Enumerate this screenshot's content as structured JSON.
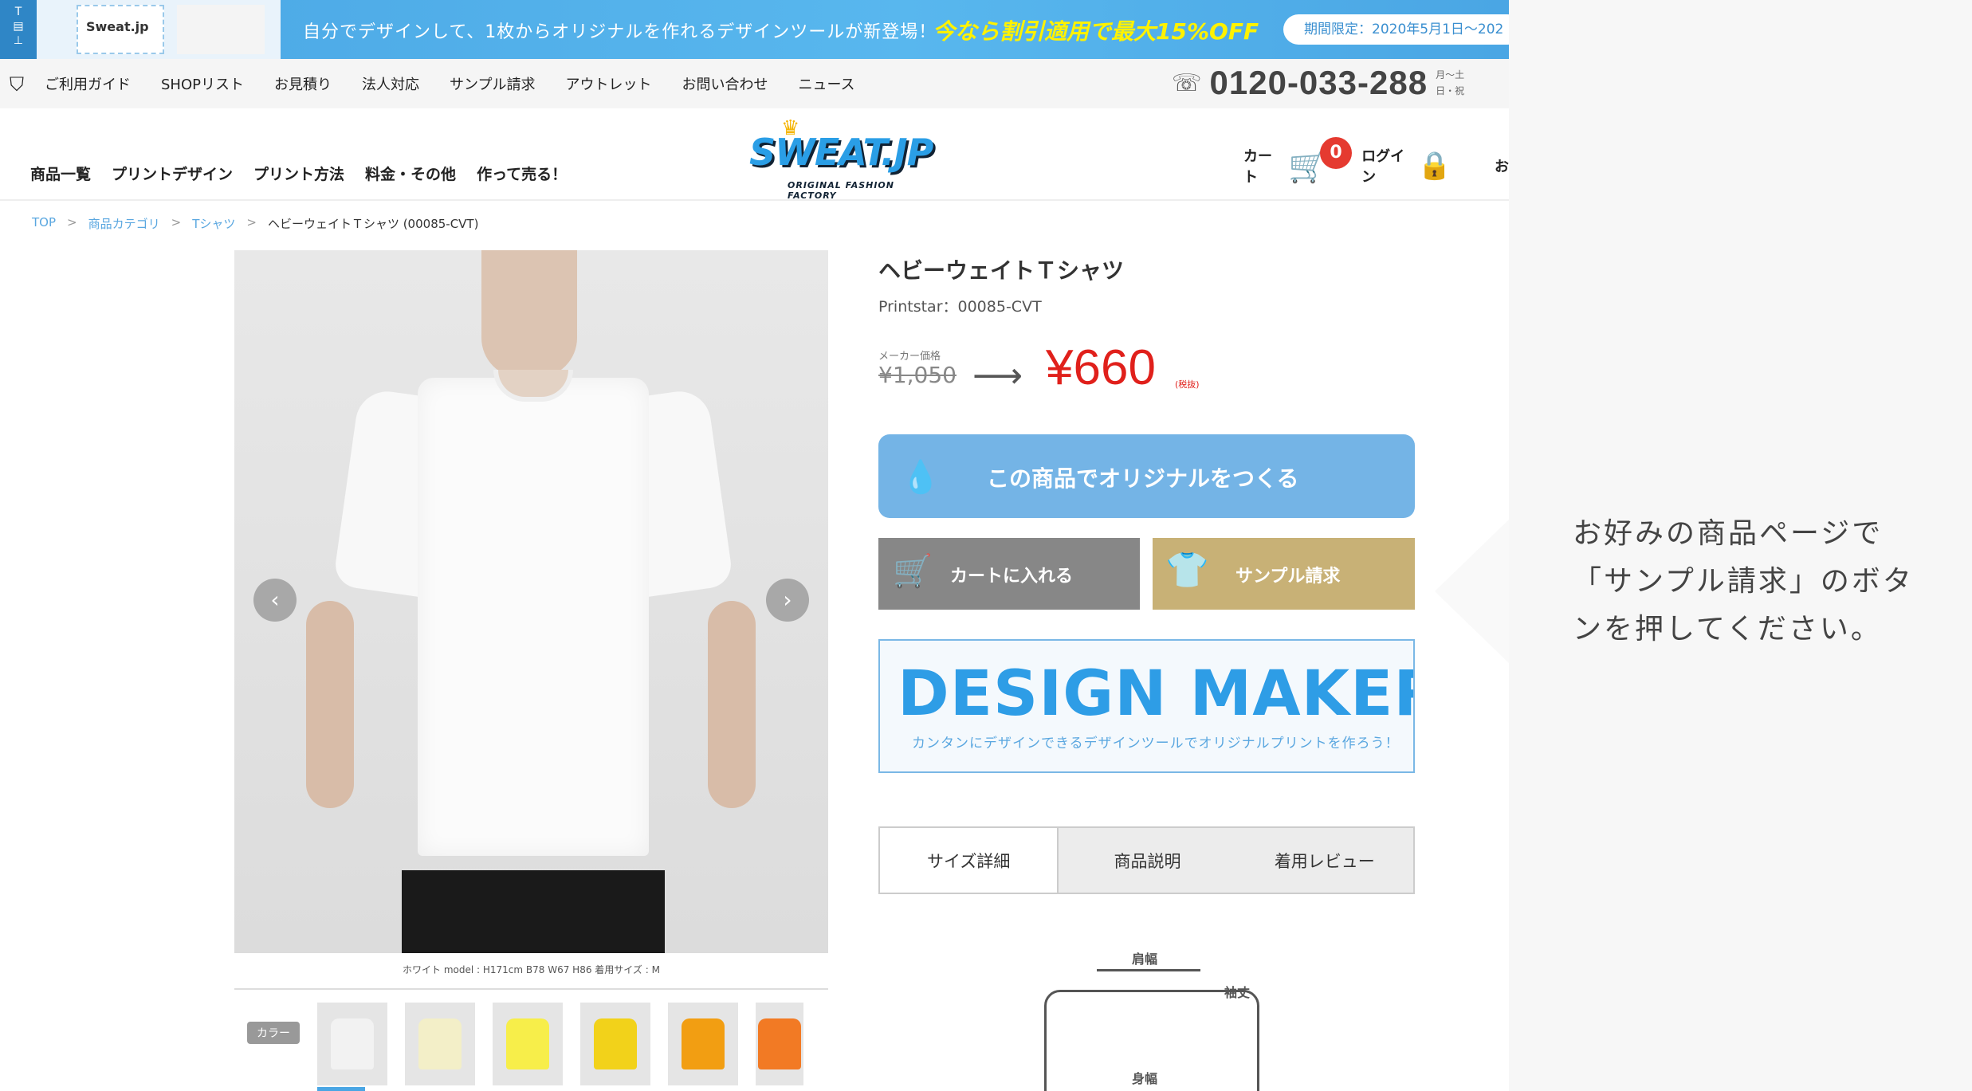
{
  "banner": {
    "tool_icon_top": "T",
    "thumb_logo": "Sweat.jp",
    "text": "自分でデザインして、1枚からオリジナルを作れるデザインツールが新登場！",
    "offer": "今なら割引適用で最大15%OFF",
    "period": "期間限定：2020年5月1日〜202"
  },
  "topnav": {
    "items": [
      "ご利用ガイド",
      "SHOPリスト",
      "お見積り",
      "法人対応",
      "サンプル請求",
      "アウトレット",
      "お問い合わせ",
      "ニュース"
    ],
    "phone": "0120-033-288",
    "hours_1": "月〜土",
    "hours_2": "日・祝"
  },
  "header": {
    "nav": [
      "商品一覧",
      "プリントデザイン",
      "プリント方法",
      "料金・その他",
      "作って売る！"
    ],
    "logo": "SWEAT.JP",
    "logo_tag": "ORIGINAL FASHION FACTORY",
    "cart_label": "カート",
    "cart_count": "0",
    "login_label": "ログイン",
    "more_label": "お"
  },
  "breadcrumb": {
    "items": [
      "TOP",
      "商品カテゴリ",
      "Tシャツ"
    ],
    "current": "ヘビーウェイトＴシャツ (00085-CVT)",
    "separator": ">"
  },
  "gallery": {
    "prev": "‹",
    "next": "›",
    "caption": "ホワイト model : H171cm B78 W67 H86 着用サイズ : M",
    "color_label": "カラー",
    "thumb_colors": [
      "#f2f2f2",
      "#f3efc8",
      "#f7ee4a",
      "#f2d21a",
      "#f29e12",
      "#f27a24"
    ]
  },
  "product": {
    "title": "ヘビーウェイトＴシャツ",
    "code": "Printstar：00085-CVT",
    "maker_price_label": "メーカー価格",
    "maker_price": "¥1,050",
    "price": "¥660",
    "tax": "(税抜)"
  },
  "actions": {
    "original": "この商品でオリジナルをつくる",
    "cart": "カートに入れる",
    "sample": "サンプル請求"
  },
  "design_maker": {
    "title": "DESIGN MAKER",
    "subtitle": "カンタンにデザインできるデザインツールでオリジナルプリントを作ろう！"
  },
  "tabs": [
    "サイズ詳細",
    "商品説明",
    "着用レビュー"
  ],
  "size_diagram": {
    "shoulder": "肩幅",
    "sleeve": "袖丈",
    "body": "身幅"
  },
  "annotation": {
    "text": "お好みの商品ページで「サンプル請求」のボタンを押してください。"
  }
}
